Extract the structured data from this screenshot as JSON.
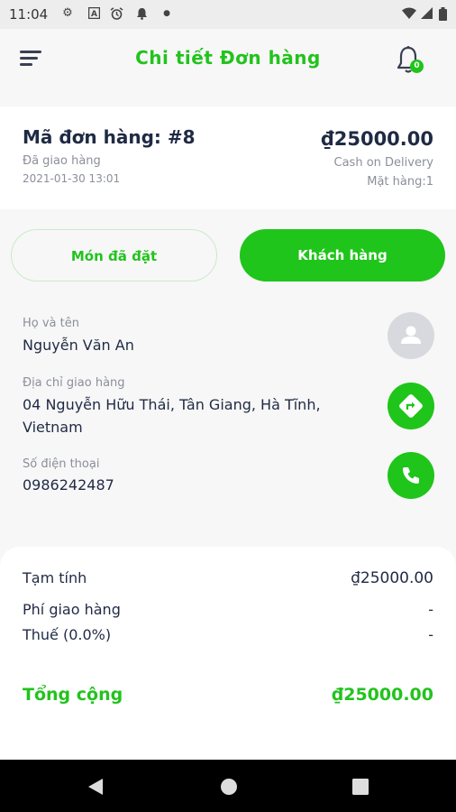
{
  "status_bar": {
    "time": "11:04",
    "icons": [
      "settings-icon",
      "text-icon",
      "alarm-icon",
      "notification-icon",
      "dot-icon",
      "wifi-icon",
      "signal-icon",
      "battery-icon"
    ]
  },
  "header": {
    "title": "Chi tiết Đơn hàng",
    "notification_count": "0"
  },
  "order": {
    "id": "Mã đơn hàng: #8",
    "status": "Đã giao hàng",
    "date": "2021-01-30 13:01",
    "price": "₫25000.00",
    "payment_method": "Cash on Delivery",
    "item_count": "Mặt hàng:1"
  },
  "tabs": {
    "ordered_label": "Món đã đặt",
    "customer_label": "Khách hàng"
  },
  "customer": {
    "name_label": "Họ và tên",
    "name": "Nguyễn Văn An",
    "address_label": "Địa chỉ giao hàng",
    "address": "04 Nguyễn Hữu Thái, Tân Giang, Hà Tĩnh, Vietnam",
    "phone_label": "Số điện thoại",
    "phone": "0986242487"
  },
  "summary": {
    "subtotal_label": "Tạm tính",
    "subtotal": "₫25000.00",
    "shipping_label": "Phí giao hàng",
    "shipping": "-",
    "tax_label": "Thuế (0.0%)",
    "tax": "-",
    "total_label": "Tổng cộng",
    "total": "₫25000.00"
  },
  "colors": {
    "accent": "#1fc51a",
    "text_dark": "#1f2a44",
    "text_muted": "#8b8f9a"
  }
}
